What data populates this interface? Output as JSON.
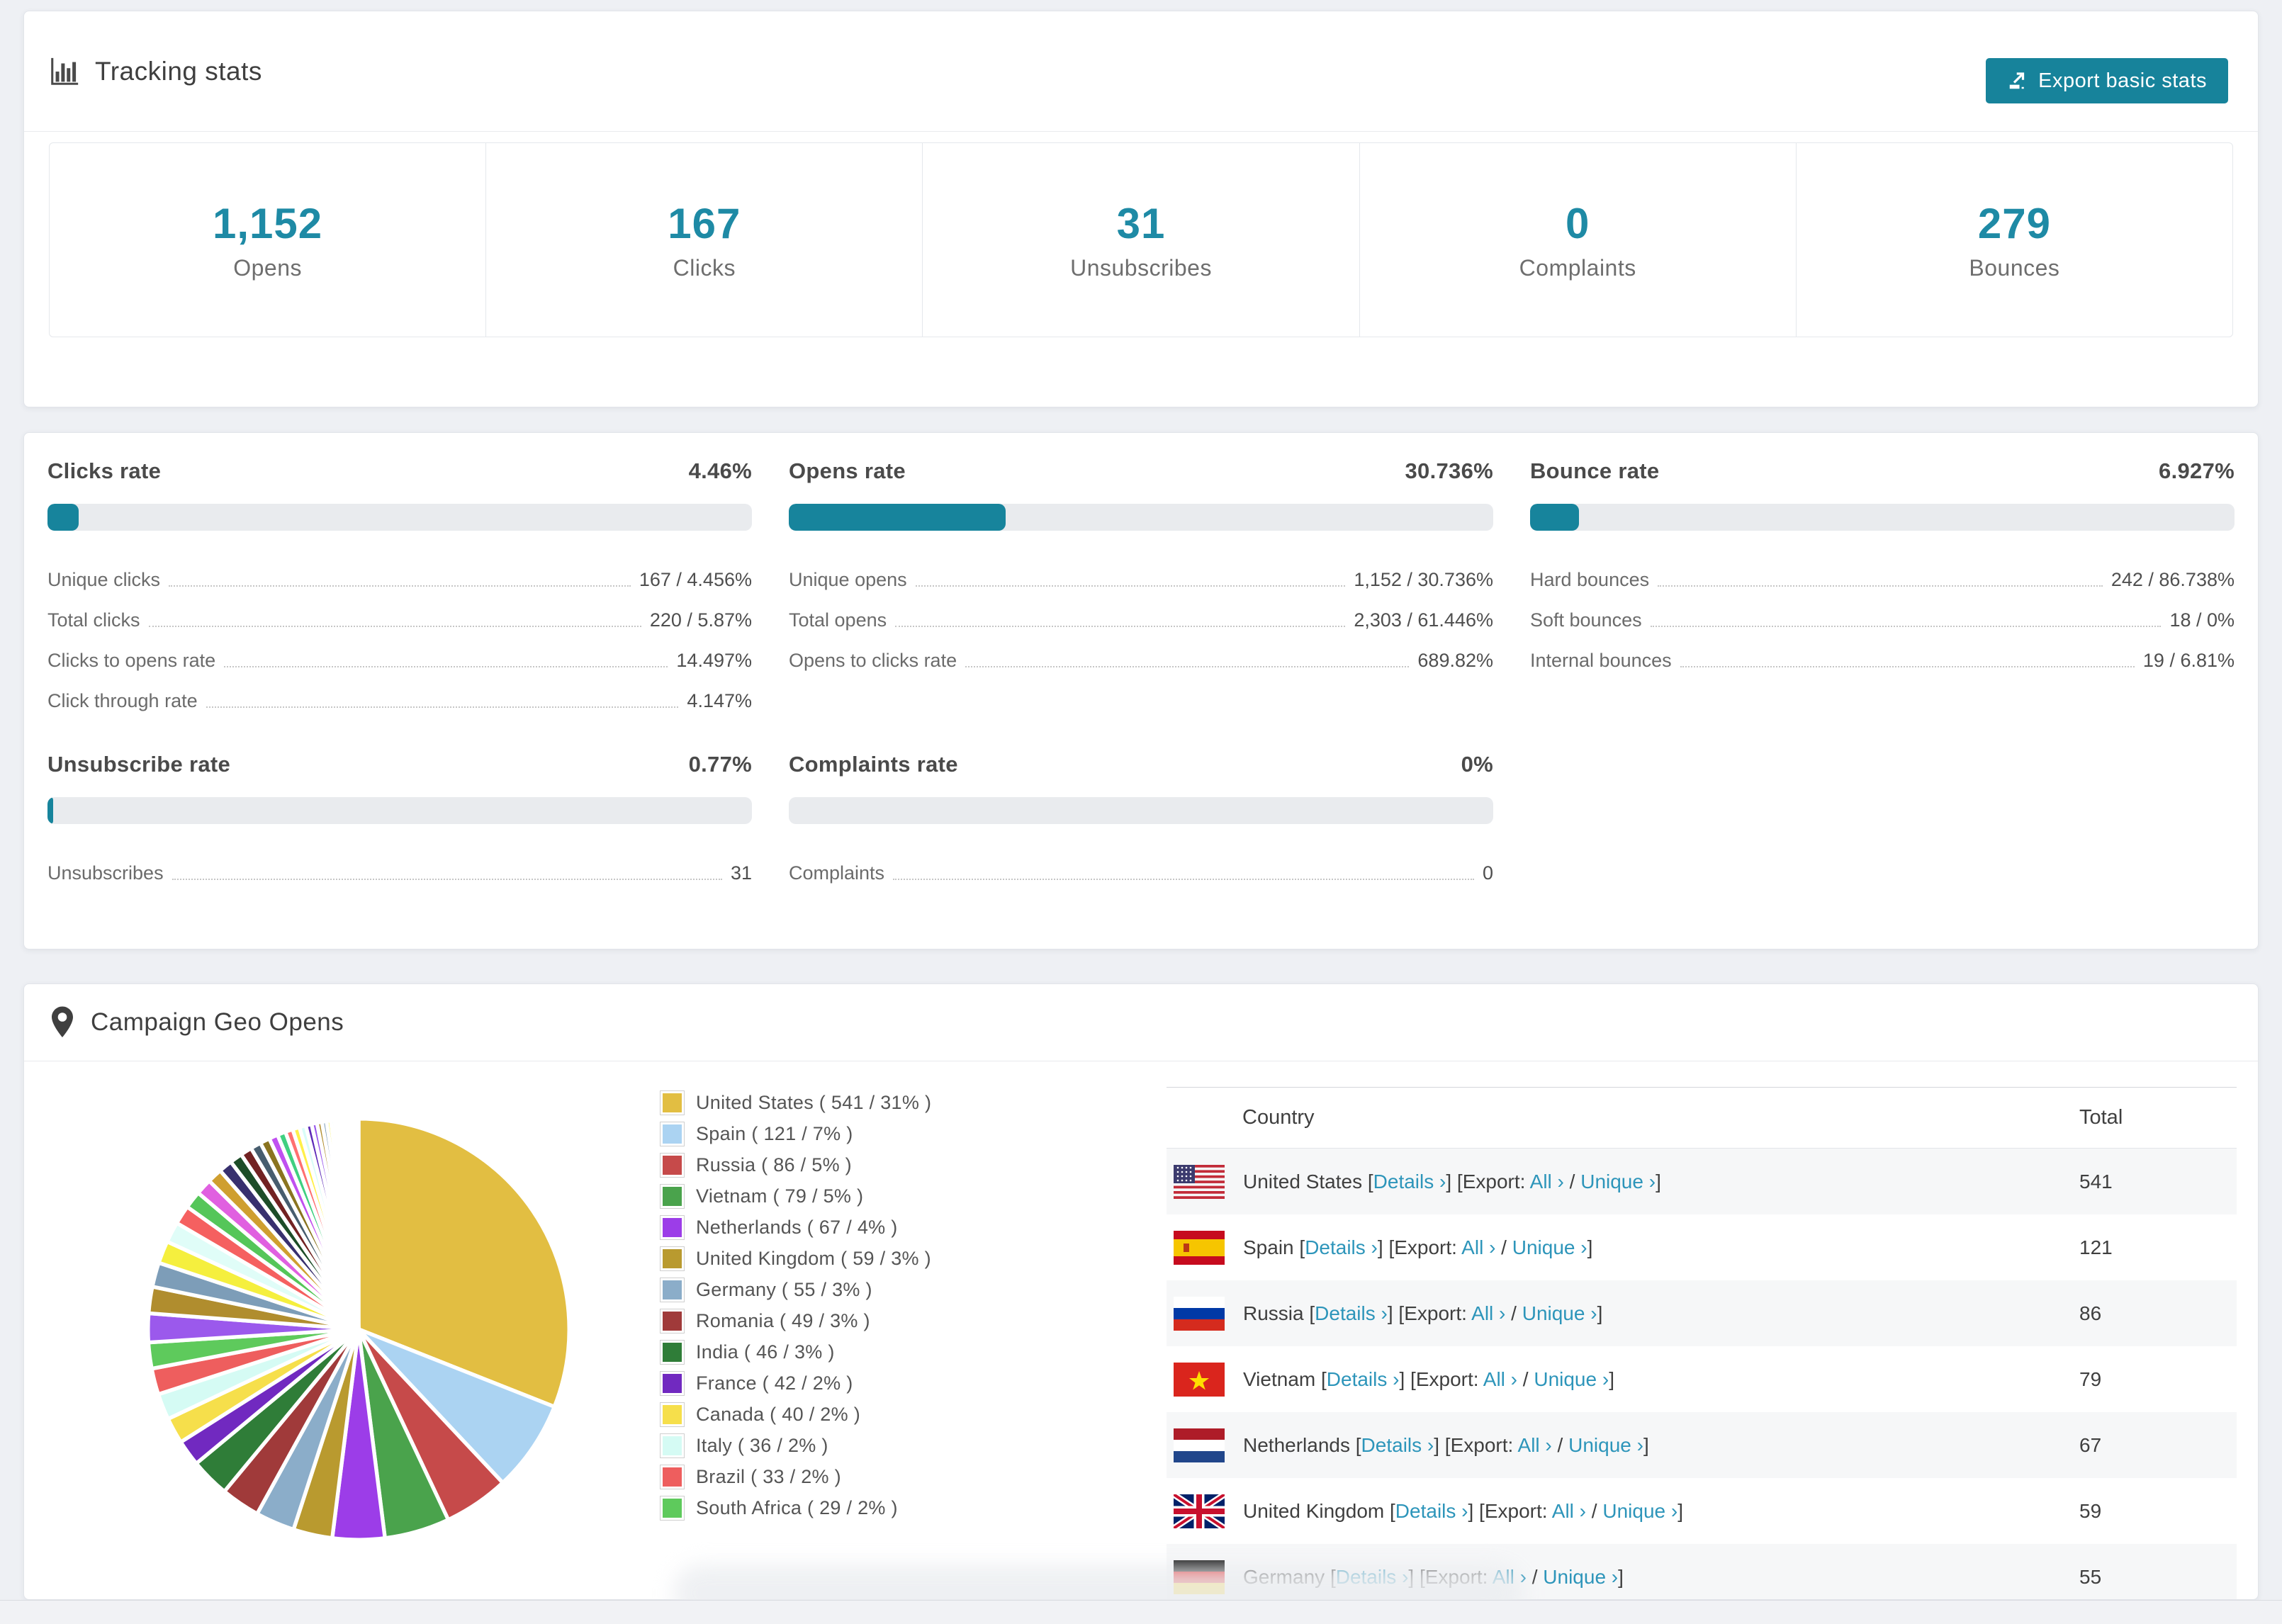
{
  "accent": "#17849c",
  "link_color": "#2d95ba",
  "tracking": {
    "title": "Tracking stats",
    "export_button": "Export basic stats",
    "stats": [
      {
        "value": "1,152",
        "label": "Opens"
      },
      {
        "value": "167",
        "label": "Clicks"
      },
      {
        "value": "31",
        "label": "Unsubscribes"
      },
      {
        "value": "0",
        "label": "Complaints"
      },
      {
        "value": "279",
        "label": "Bounces"
      }
    ]
  },
  "rates": {
    "clicks": {
      "title": "Clicks rate",
      "value": "4.46%",
      "percent": 4.46,
      "rows": [
        {
          "label": "Unique clicks",
          "value": "167 / 4.456%"
        },
        {
          "label": "Total clicks",
          "value": "220 / 5.87%"
        },
        {
          "label": "Clicks to opens rate",
          "value": "14.497%"
        },
        {
          "label": "Click through rate",
          "value": "4.147%"
        }
      ]
    },
    "opens": {
      "title": "Opens rate",
      "value": "30.736%",
      "percent": 30.736,
      "rows": [
        {
          "label": "Unique opens",
          "value": "1,152 / 30.736%"
        },
        {
          "label": "Total opens",
          "value": "2,303 / 61.446%"
        },
        {
          "label": "Opens to clicks rate",
          "value": "689.82%"
        }
      ]
    },
    "bounce": {
      "title": "Bounce rate",
      "value": "6.927%",
      "percent": 6.927,
      "rows": [
        {
          "label": "Hard bounces",
          "value": "242 / 86.738%"
        },
        {
          "label": "Soft bounces",
          "value": "18 / 0%"
        },
        {
          "label": "Internal bounces",
          "value": "19 / 6.81%"
        }
      ]
    },
    "unsubscribe": {
      "title": "Unsubscribe rate",
      "value": "0.77%",
      "percent": 0.77,
      "rows": [
        {
          "label": "Unsubscribes",
          "value": "31"
        }
      ]
    },
    "complaints": {
      "title": "Complaints rate",
      "value": "0%",
      "percent": 0,
      "rows": [
        {
          "label": "Complaints",
          "value": "0"
        }
      ]
    }
  },
  "geo": {
    "title": "Campaign Geo Opens",
    "table": {
      "columns": [
        "Country",
        "Total"
      ],
      "link_labels": {
        "details": "Details",
        "export": "Export:",
        "all": "All",
        "unique": "Unique"
      },
      "rows": [
        {
          "country": "United States",
          "flag": "us",
          "total": "541"
        },
        {
          "country": "Spain",
          "flag": "es",
          "total": "121"
        },
        {
          "country": "Russia",
          "flag": "ru",
          "total": "86"
        },
        {
          "country": "Vietnam",
          "flag": "vn",
          "total": "79"
        },
        {
          "country": "Netherlands",
          "flag": "nl",
          "total": "67"
        },
        {
          "country": "United Kingdom",
          "flag": "gb",
          "total": "59"
        },
        {
          "country": "Germany",
          "flag": "de",
          "total": "55"
        }
      ]
    },
    "chart_data": {
      "type": "pie",
      "title": "Campaign Geo Opens",
      "legend_position": "right",
      "slices": [
        {
          "label": "United States",
          "count": 541,
          "percent": 31,
          "color": "#e2be42"
        },
        {
          "label": "Spain",
          "count": 121,
          "percent": 7,
          "color": "#abd3f2"
        },
        {
          "label": "Russia",
          "count": 86,
          "percent": 5,
          "color": "#c64a4a"
        },
        {
          "label": "Vietnam",
          "count": 79,
          "percent": 5,
          "color": "#4aa34c"
        },
        {
          "label": "Netherlands",
          "count": 67,
          "percent": 4,
          "color": "#9c3de8"
        },
        {
          "label": "United Kingdom",
          "count": 59,
          "percent": 3,
          "color": "#b99a2f"
        },
        {
          "label": "Germany",
          "count": 55,
          "percent": 3,
          "color": "#8badc9"
        },
        {
          "label": "Romania",
          "count": 49,
          "percent": 3,
          "color": "#a03a3a"
        },
        {
          "label": "India",
          "count": 46,
          "percent": 3,
          "color": "#2f7d38"
        },
        {
          "label": "France",
          "count": 42,
          "percent": 2,
          "color": "#7129c0"
        },
        {
          "label": "Canada",
          "count": 40,
          "percent": 2,
          "color": "#f6df4b"
        },
        {
          "label": "Italy",
          "count": 36,
          "percent": 2,
          "color": "#d5fbf4"
        },
        {
          "label": "Brazil",
          "count": 33,
          "percent": 2,
          "color": "#ee5e5e"
        },
        {
          "label": "South Africa",
          "count": 29,
          "percent": 2,
          "color": "#5eca5c"
        }
      ],
      "other": {
        "percent": 26,
        "colors": [
          "#9b59ec",
          "#b08d2e",
          "#7d9db8",
          "#f5ef3e",
          "#e0fdf8",
          "#f56060",
          "#55c659",
          "#e060e0",
          "#cf9f30",
          "#38306e",
          "#1d4d28",
          "#722222",
          "#475d6e",
          "#8a7420",
          "#c050f0",
          "#40d080",
          "#ff7070",
          "#fff04a",
          "#d8fdf8",
          "#5e2bb8"
        ]
      }
    }
  }
}
